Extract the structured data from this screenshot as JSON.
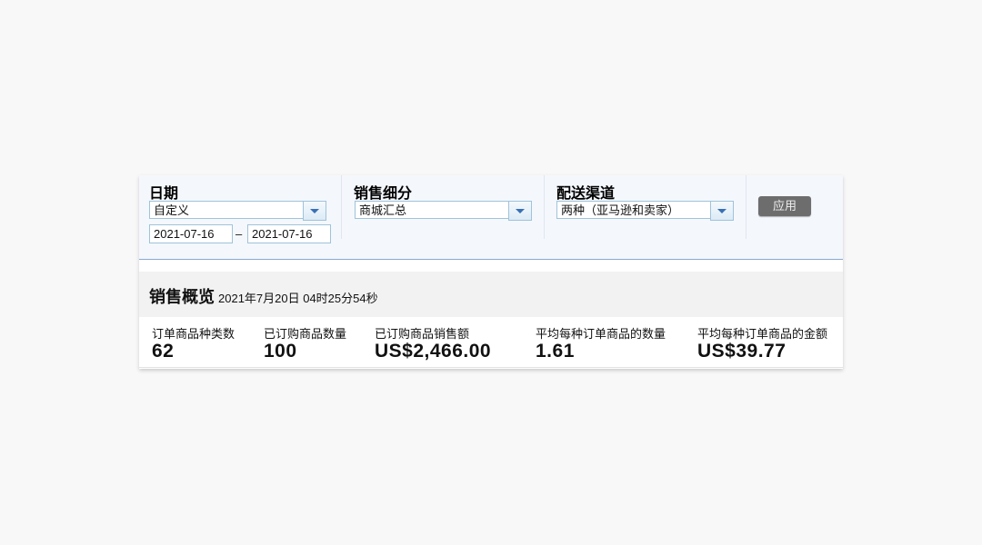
{
  "filters": {
    "date": {
      "label": "日期",
      "range_type": "自定义",
      "start": "2021-07-16",
      "separator": "–",
      "end": "2021-07-16"
    },
    "segment": {
      "label": "销售细分",
      "value": "商城汇总"
    },
    "channel": {
      "label": "配送渠道",
      "value": "两种（亚马逊和卖家）"
    },
    "apply_label": "应用"
  },
  "summary": {
    "title": "销售概览",
    "timestamp": "2021年7月20日 04时25分54秒",
    "metrics": [
      {
        "label": "订单商品种类数",
        "value": "62"
      },
      {
        "label": "已订购商品数量",
        "value": "100"
      },
      {
        "label": "已订购商品销售额",
        "value": "US$2,466.00"
      },
      {
        "label": "平均每种订单商品的数量",
        "value": "1.61"
      },
      {
        "label": "平均每种订单商品的金额",
        "value": "US$39.77"
      }
    ]
  },
  "colors": {
    "accent_border": "#9fc3da",
    "header_bg": "#f4f7fc",
    "apply_bg": "#6d6d6d"
  }
}
